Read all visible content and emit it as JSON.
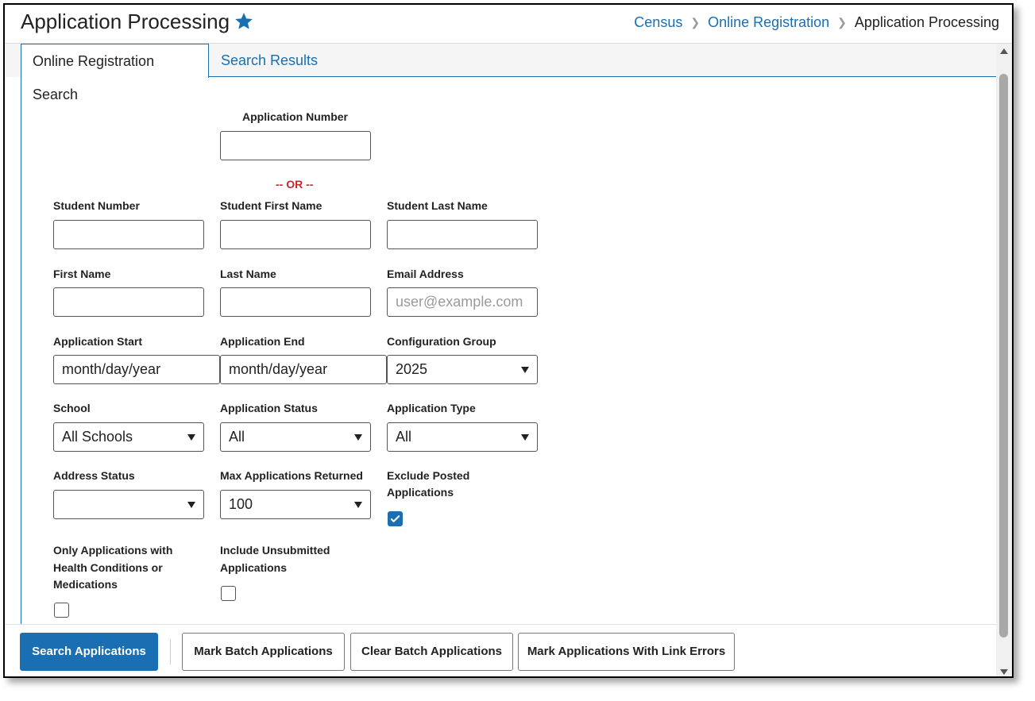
{
  "header": {
    "title": "Application Processing",
    "breadcrumb": [
      "Census",
      "Online Registration",
      "Application Processing"
    ],
    "favorite_icon": "star-icon",
    "accent_color": "#1a6fb3"
  },
  "tabs": [
    {
      "label": "Online Registration Search",
      "active": true
    },
    {
      "label": "Search Results",
      "active": false
    }
  ],
  "form": {
    "application_number": {
      "label": "Application Number",
      "value": ""
    },
    "or_text": "-- OR --",
    "student_number": {
      "label": "Student Number",
      "value": ""
    },
    "student_first_name": {
      "label": "Student First Name",
      "value": ""
    },
    "student_last_name": {
      "label": "Student Last Name",
      "value": ""
    },
    "first_name": {
      "label": "First Name",
      "value": ""
    },
    "last_name": {
      "label": "Last Name",
      "value": ""
    },
    "email_address": {
      "label": "Email Address",
      "value": "",
      "placeholder": "user@example.com"
    },
    "application_start": {
      "label": "Application Start",
      "value": "month/day/year"
    },
    "application_end": {
      "label": "Application End",
      "value": "month/day/year"
    },
    "configuration_group": {
      "label": "Configuration Group",
      "value": "2025"
    },
    "school": {
      "label": "School",
      "value": "All Schools"
    },
    "application_status": {
      "label": "Application Status",
      "value": "All"
    },
    "application_type": {
      "label": "Application Type",
      "value": "All"
    },
    "address_status": {
      "label": "Address Status",
      "value": ""
    },
    "max_applications": {
      "label": "Max Applications Returned",
      "value": "100"
    },
    "exclude_posted": {
      "label_line1": "Exclude Posted",
      "label_line2": "Applications",
      "checked": true
    },
    "health_conditions": {
      "label_line1": "Only Applications with",
      "label_line2": "Health Conditions or",
      "label_line3": "Medications",
      "checked": false
    },
    "include_unsubmitted": {
      "label_line1": "Include Unsubmitted",
      "label_line2": "Applications",
      "checked": false
    }
  },
  "footer": {
    "search_button": "Search Applications",
    "mark_batch_button": "Mark Batch Applications",
    "clear_batch_button": "Clear Batch Applications",
    "mark_link_errors_button": "Mark Applications With Link Errors"
  }
}
